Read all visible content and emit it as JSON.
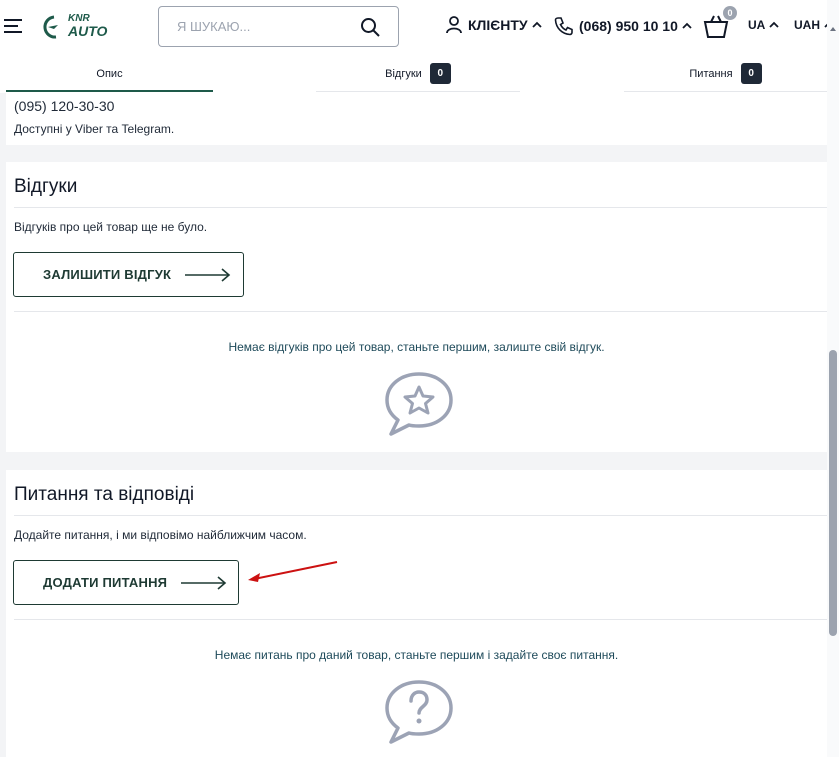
{
  "header": {
    "logo_text_top": "KNR",
    "logo_text_bottom": "AUTO",
    "search_placeholder": "Я ШУКАЮ...",
    "client_label": "КЛІЄНТУ",
    "phone_label": "(068) 950 10 10",
    "cart_count": "0",
    "lang": "UA",
    "currency": "UAH"
  },
  "tabs": [
    {
      "label": "Опис"
    },
    {
      "label": "Відгуки",
      "count": "0"
    },
    {
      "label": "Питання",
      "count": "0"
    }
  ],
  "contact": {
    "phone": "(095) 120-30-30",
    "note": "Доступні у Viber та Telegram."
  },
  "reviews": {
    "title": "Відгуки",
    "desc": "Відгуків про цей товар ще не було.",
    "button_label": "ЗАЛИШИТИ ВІДГУК",
    "empty_message": "Немає відгуків про цей товар, станьте першим, залиште свій відгук."
  },
  "questions": {
    "title": "Питання та відповіді",
    "desc": "Додайте питання, і ми відповімо найближчим часом.",
    "button_label": "ДОДАТИ ПИТАННЯ",
    "empty_message": "Немає питань про даний товар, станьте першим і задайте своє питання."
  },
  "colors": {
    "accent": "#1e5a4a",
    "annotation": "#cc1111",
    "icon_gray": "#9ca3b5"
  }
}
